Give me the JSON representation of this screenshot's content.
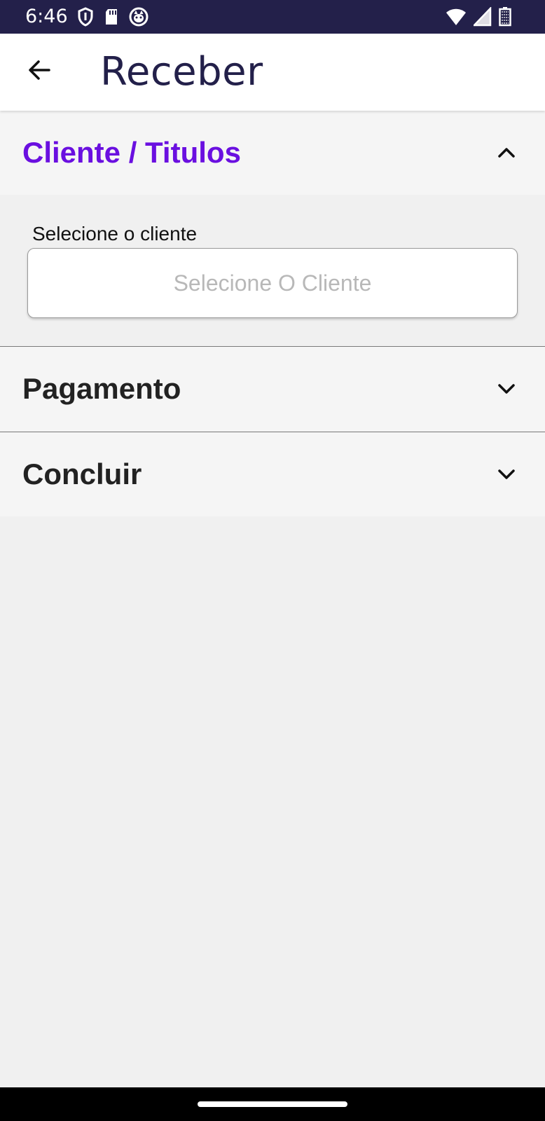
{
  "status_bar": {
    "time": "6:46",
    "left_icons": [
      "shield-icon",
      "sd-card-icon",
      "cat-face-icon"
    ],
    "right_icons": [
      "wifi-icon",
      "cellular-signal-icon",
      "battery-icon"
    ]
  },
  "app_bar": {
    "title": "Receber",
    "back_icon": "arrow-left-icon"
  },
  "sections": [
    {
      "title": "Cliente / Titulos",
      "expanded": true,
      "chevron": "chevron-up-icon"
    },
    {
      "title": "Pagamento",
      "expanded": false,
      "chevron": "chevron-down-icon"
    },
    {
      "title": "Concluir",
      "expanded": false,
      "chevron": "chevron-down-icon"
    }
  ],
  "client_field": {
    "label": "Selecione o cliente",
    "placeholder": "Selecione O Cliente"
  },
  "colors": {
    "status_bar": "#23204a",
    "accent": "#6a0fe0",
    "title": "#23204a"
  }
}
